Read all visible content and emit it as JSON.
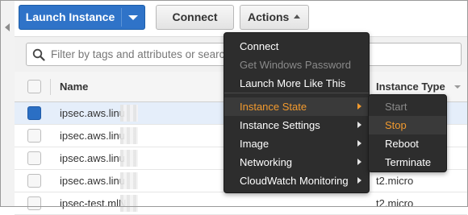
{
  "toolbar": {
    "launch_label": "Launch Instance",
    "connect_label": "Connect",
    "actions_label": "Actions"
  },
  "search": {
    "placeholder": "Filter by tags and attributes or search by keyword"
  },
  "table": {
    "columns": [
      "Name",
      "Instance Type"
    ],
    "rows": [
      {
        "name": "ipsec.aws.linu",
        "type": "",
        "selected": true
      },
      {
        "name": "ipsec.aws.linu",
        "type": "",
        "selected": false
      },
      {
        "name": "ipsec.aws.linu",
        "type": "",
        "selected": false
      },
      {
        "name": "ipsec.aws.linu",
        "type": "t2.micro",
        "selected": false
      },
      {
        "name": "ipsec-test.mlN",
        "type": "t2.micro",
        "selected": false
      }
    ]
  },
  "actions_menu": {
    "items": [
      {
        "label": "Connect",
        "state": "normal",
        "submenu": false
      },
      {
        "label": "Get Windows Password",
        "state": "disabled",
        "submenu": false
      },
      {
        "label": "Launch More Like This",
        "state": "normal",
        "submenu": false
      },
      {
        "label": "Instance State",
        "state": "active",
        "submenu": true
      },
      {
        "label": "Instance Settings",
        "state": "normal",
        "submenu": true
      },
      {
        "label": "Image",
        "state": "normal",
        "submenu": true
      },
      {
        "label": "Networking",
        "state": "normal",
        "submenu": true
      },
      {
        "label": "CloudWatch Monitoring",
        "state": "normal",
        "submenu": true
      }
    ]
  },
  "instance_state_menu": {
    "items": [
      {
        "label": "Start",
        "state": "disabled"
      },
      {
        "label": "Stop",
        "state": "active"
      },
      {
        "label": "Reboot",
        "state": "normal"
      },
      {
        "label": "Terminate",
        "state": "normal"
      }
    ]
  },
  "colors": {
    "primary": "#2f73c8",
    "menu_bg": "#2d2d2d",
    "menu_highlight": "#f29a2e",
    "selected_row": "#e5eefa"
  },
  "icons": [
    "search-icon",
    "chevron-down-icon",
    "chevron-up-icon",
    "chevron-right-icon",
    "collapse-arrow-icon",
    "sort-icon"
  ]
}
